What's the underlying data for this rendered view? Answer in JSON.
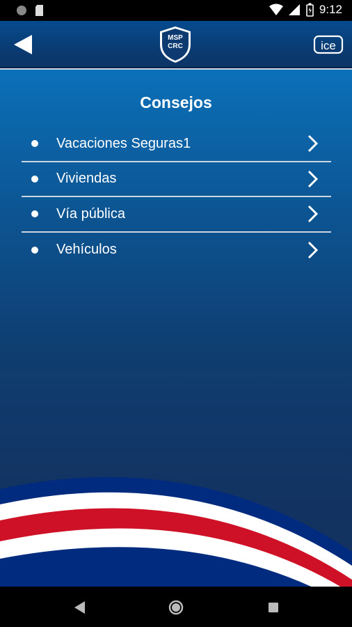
{
  "status_bar": {
    "time": "9:12",
    "icons": [
      "circle-notification-icon",
      "sd-card-icon",
      "wifi-icon",
      "cell-signal-icon",
      "battery-icon"
    ]
  },
  "app_bar": {
    "back_icon": "back-arrow-icon",
    "logo_text_line1": "MSP",
    "logo_text_line2": "CRC",
    "right_logo": "ice"
  },
  "page": {
    "title": "Consejos"
  },
  "menu": {
    "items": [
      {
        "label": "Vacaciones Seguras1"
      },
      {
        "label": "Viviendas"
      },
      {
        "label": "Vía pública"
      },
      {
        "label": "Vehículos"
      }
    ]
  },
  "colors": {
    "flag_blue": "#002b7f",
    "flag_white": "#ffffff",
    "flag_red": "#ce1126",
    "bg_top": "#0b70b8",
    "bg_bottom": "#13305c"
  },
  "nav_bar": {
    "icons": [
      "back-triangle-icon",
      "home-circle-icon",
      "recents-square-icon"
    ]
  }
}
